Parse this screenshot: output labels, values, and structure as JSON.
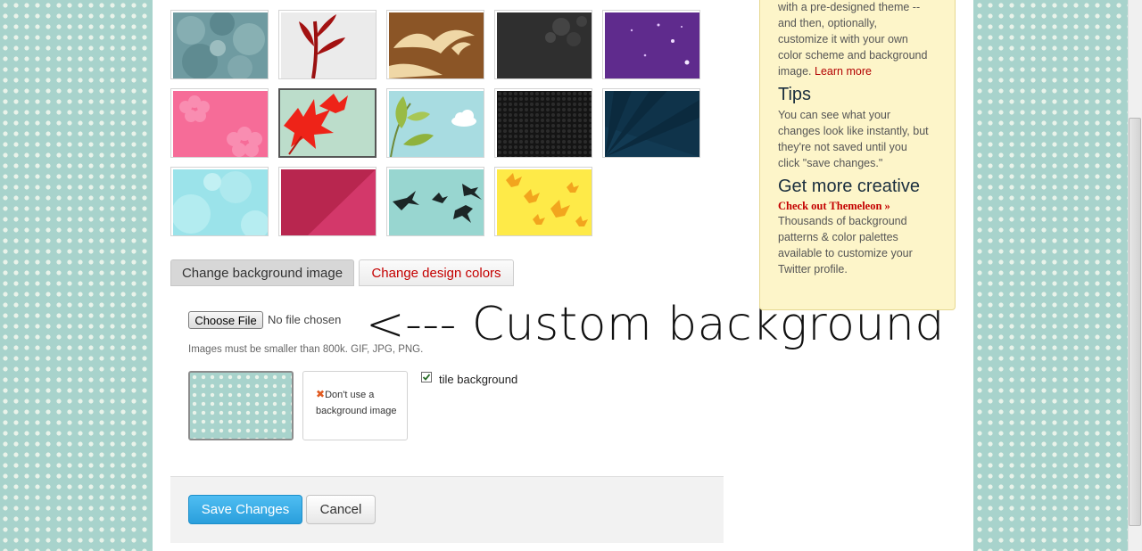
{
  "thumbnails": [
    {
      "name": "theme-misty-trees",
      "selected": false
    },
    {
      "name": "theme-red-plant",
      "selected": false
    },
    {
      "name": "theme-brown-birds",
      "selected": false
    },
    {
      "name": "theme-dark-grunge",
      "selected": false
    },
    {
      "name": "theme-purple-stars",
      "selected": false
    },
    {
      "name": "theme-pink-flowers",
      "selected": false
    },
    {
      "name": "theme-red-leaves",
      "selected": true
    },
    {
      "name": "theme-leaves-clouds",
      "selected": false
    },
    {
      "name": "theme-black-honeycomb",
      "selected": false
    },
    {
      "name": "theme-navy-rays",
      "selected": false
    },
    {
      "name": "theme-cyan-bubbles",
      "selected": false
    },
    {
      "name": "theme-crimson-diagonal",
      "selected": false
    },
    {
      "name": "theme-flying-birds",
      "selected": false
    },
    {
      "name": "theme-yellow-leaves",
      "selected": false
    }
  ],
  "tabs": {
    "background": "Change background image",
    "colors": "Change design colors"
  },
  "upload": {
    "button_label": "Choose File",
    "status": "No file chosen",
    "annotation": "<--- Custom background",
    "hint": "Images must be smaller than 800k. GIF, JPG, PNG."
  },
  "options": {
    "no_bg_label": "Don't use a background image",
    "tile_label": "tile background",
    "tile_checked": true
  },
  "actions": {
    "save": "Save Changes",
    "cancel": "Cancel"
  },
  "help": {
    "intro_lines": [
      "with a pre-designed theme --",
      "and then, optionally,",
      "customize it with your own",
      "color scheme and background",
      "image."
    ],
    "learn_more": "Learn more",
    "tips_heading": "Tips",
    "tips_lines": [
      "You can see what your",
      "changes look like instantly, but",
      "they're not saved until you",
      "click \"save changes.\""
    ],
    "creative_heading": "Get more creative",
    "creative_link": "Check out Themeleon »",
    "creative_lines": [
      "Thousands of background",
      "patterns & color palettes",
      "available to customize your",
      "Twitter profile."
    ]
  },
  "colors": {
    "accent_blue": "#2a9fdc",
    "link_red": "#c40000",
    "help_bg": "#fdf5c9",
    "page_bg": "#a8d3cc"
  }
}
